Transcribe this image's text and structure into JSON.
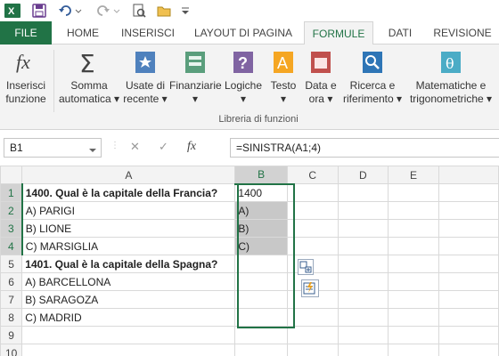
{
  "tabs": [
    "FILE",
    "HOME",
    "INSERISCI",
    "LAYOUT DI PAGINA",
    "FORMULE",
    "DATI",
    "REVISIONE"
  ],
  "ribbon": {
    "buttons": [
      {
        "l1": "Inserisci",
        "l2": "funzione",
        "icon": "insert-function-icon"
      },
      {
        "l1": "Somma",
        "l2": "automatica ▾",
        "icon": "autosum-icon"
      },
      {
        "l1": "Usate di",
        "l2": "recente ▾",
        "icon": "recently-used-icon"
      },
      {
        "l1": "Finanziarie",
        "l2": "▾",
        "icon": "financial-icon"
      },
      {
        "l1": "Logiche",
        "l2": "▾",
        "icon": "logical-icon"
      },
      {
        "l1": "Testo",
        "l2": "▾",
        "icon": "text-icon"
      },
      {
        "l1": "Data e",
        "l2": "ora ▾",
        "icon": "date-time-icon"
      },
      {
        "l1": "Ricerca e",
        "l2": "riferimento ▾",
        "icon": "lookup-reference-icon"
      },
      {
        "l1": "Matematiche e",
        "l2": "trigonometriche ▾",
        "icon": "math-trig-icon"
      }
    ],
    "group_label": "Libreria di funzioni"
  },
  "formula_bar": {
    "name_box": "B1",
    "cancel": "✕",
    "enter": "✓",
    "fx": "fx",
    "formula": "=SINISTRA(A1;4)"
  },
  "columns": [
    "A",
    "B",
    "C",
    "D",
    "E"
  ],
  "rows": [
    {
      "n": "1",
      "a": "1400. Qual è la capitale della Francia?",
      "b": "1400"
    },
    {
      "n": "2",
      "a": "A) PARIGI",
      "b": "A)"
    },
    {
      "n": "3",
      "a": "B) LIONE",
      "b": "B)"
    },
    {
      "n": "4",
      "a": "C) MARSIGLIA",
      "b": "C)"
    },
    {
      "n": "5",
      "a": "1401. Qual è la capitale della Spagna?",
      "b": ""
    },
    {
      "n": "6",
      "a": "A) BARCELLONA",
      "b": ""
    },
    {
      "n": "7",
      "a": "B) SARAGOZA",
      "b": ""
    },
    {
      "n": "8",
      "a": "C) MADRID",
      "b": ""
    },
    {
      "n": "9",
      "a": "",
      "b": ""
    },
    {
      "n": "10",
      "a": "",
      "b": ""
    }
  ]
}
